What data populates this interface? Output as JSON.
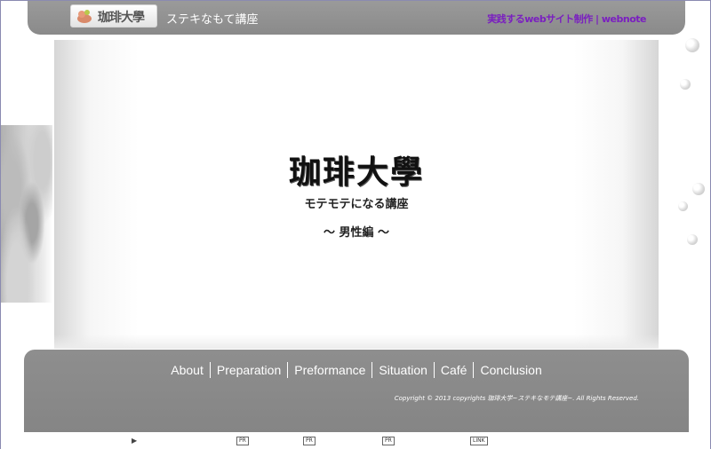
{
  "header": {
    "logo_text": "珈琲大學",
    "subtitle": "ステキなもて講座",
    "ext_link": "実践するwebサイト制作 | webnote"
  },
  "hero": {
    "logo_text": "珈琲大學",
    "subtitle1": "モテモテになる講座",
    "subtitle2": "～ 男性編 ～"
  },
  "nav": {
    "items": [
      "About",
      "Preparation",
      "Preformance",
      "Situation",
      "Café",
      "Conclusion"
    ]
  },
  "footer": {
    "copyright": "Copyright © 2013 copyrights 珈琲大学~ステキなモテ講座~. All Rights Reserved."
  },
  "adbar": {
    "arrow": "▶",
    "tags": [
      "PR",
      "PR",
      "PR",
      "LINK"
    ]
  },
  "colors": {
    "header_bg": "#8a8a8a",
    "footer_bg": "#858585",
    "link_purple": "#7a1fc0"
  }
}
